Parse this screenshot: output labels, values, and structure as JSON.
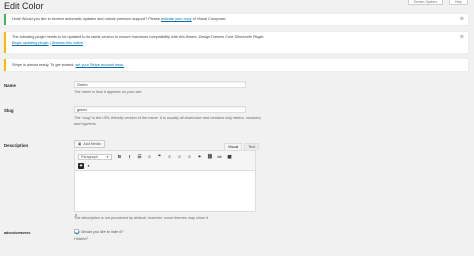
{
  "header": {
    "title": "Edit Color",
    "top_buttons": [
      "Screen Options",
      "Help"
    ]
  },
  "notices": {
    "green": {
      "text": "Hola! Would you like to receive automatic updates and unlock premium support? Please",
      "link": "activate your copy",
      "suffix": "of Visual Composer."
    },
    "yellow": {
      "line1": "The following plugin needs to be updated to its latest version to ensure maximum compatibility with this theme:",
      "plugin": "DesignThemes Core Shortcode Plugin.",
      "link1": "Begin updating plugin",
      "separator": "|",
      "link2": "Dismiss this notice"
    },
    "blue": {
      "text": "Stripe is almost ready. To get started,",
      "link": "set your Stripe account keys."
    }
  },
  "form": {
    "name_label": "Name",
    "name_value": "Green",
    "name_desc": "The name is how it appears on your site.",
    "slug_label": "Slug",
    "slug_value": "green",
    "slug_desc": "The “slug” is the URL-friendly version of the name. It is usually all lowercase and contains only letters, numbers, and hyphens.",
    "description_label": "Description",
    "add_media": "Add Media",
    "tab_visual": "Visual",
    "tab_text": "Text",
    "format_select": "Paragraph",
    "path_tag": "p",
    "description_desc": "The description is not prominent by default; however, some themes may show it.",
    "extra_label": "advcolorravees",
    "checkbox_label": "Would you like to hide it?",
    "hidden_text": "Hidden?"
  },
  "icons": {
    "toolbar": [
      "bold-icon",
      "italic-icon",
      "bullet-list-icon",
      "numbered-list-icon",
      "blockquote-icon",
      "align-left-icon",
      "align-center-icon",
      "align-right-icon",
      "link-icon",
      "unlink-icon",
      "fullscreen-icon",
      "toolbar-toggle-icon"
    ]
  }
}
